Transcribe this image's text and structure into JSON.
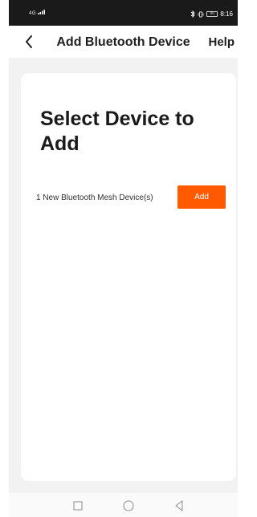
{
  "status_bar": {
    "signal": "4G",
    "battery": "80",
    "time": "8:16"
  },
  "header": {
    "back_icon": "chevron-left-icon",
    "title": "Add Bluetooth Device",
    "help_label": "Help"
  },
  "card": {
    "title": "Select Device to Add",
    "device_row": {
      "label": "1 New Bluetooth Mesh Device(s)",
      "add_label": "Add"
    }
  },
  "nav_bar": {
    "icons": [
      "square-icon",
      "circle-icon",
      "triangle-back-icon"
    ]
  },
  "colors": {
    "accent": "#ff5a00",
    "background": "#f2f2f2",
    "card": "#ffffff",
    "status_bar": "#1a1a1a"
  }
}
